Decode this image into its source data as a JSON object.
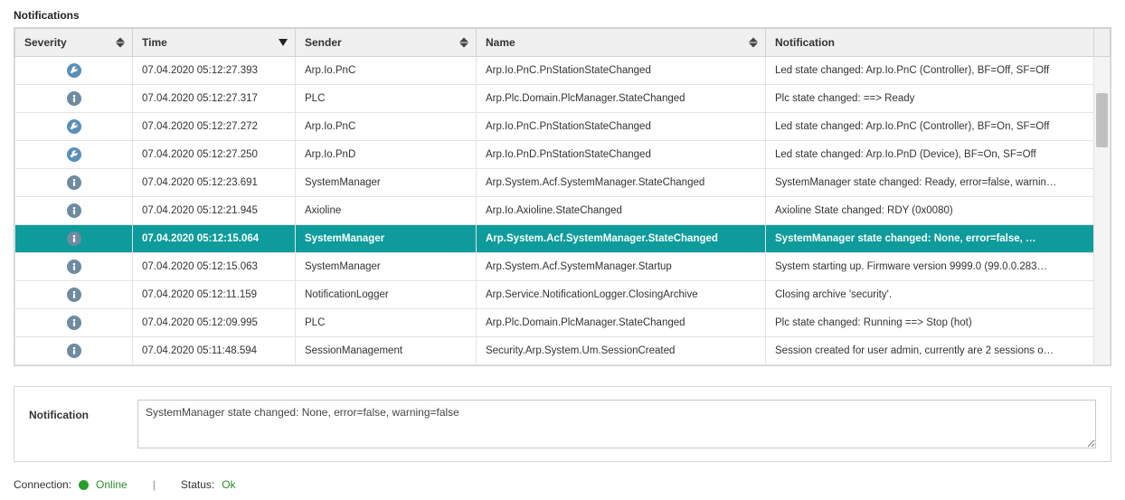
{
  "page_title": "Notifications",
  "columns": {
    "severity": "Severity",
    "time": "Time",
    "sender": "Sender",
    "name": "Name",
    "notification": "Notification"
  },
  "rows": [
    {
      "severity": "wrench",
      "time": "07.04.2020 05:12:27.393",
      "sender": "Arp.Io.PnC",
      "name": "Arp.Io.PnC.PnStationStateChanged",
      "notification": "Led state changed: Arp.Io.PnC (Controller), BF=Off, SF=Off",
      "selected": false
    },
    {
      "severity": "info",
      "time": "07.04.2020 05:12:27.317",
      "sender": "PLC",
      "name": "Arp.Plc.Domain.PlcManager.StateChanged",
      "notification": "Plc state changed: ==> Ready",
      "selected": false
    },
    {
      "severity": "wrench",
      "time": "07.04.2020 05:12:27.272",
      "sender": "Arp.Io.PnC",
      "name": "Arp.Io.PnC.PnStationStateChanged",
      "notification": "Led state changed: Arp.Io.PnC (Controller), BF=On, SF=Off",
      "selected": false
    },
    {
      "severity": "wrench",
      "time": "07.04.2020 05:12:27.250",
      "sender": "Arp.Io.PnD",
      "name": "Arp.Io.PnD.PnStationStateChanged",
      "notification": "Led state changed: Arp.Io.PnD (Device), BF=On, SF=Off",
      "selected": false
    },
    {
      "severity": "info",
      "time": "07.04.2020 05:12:23.691",
      "sender": "SystemManager",
      "name": "Arp.System.Acf.SystemManager.StateChanged",
      "notification": "SystemManager state changed: Ready, error=false, warnin…",
      "selected": false
    },
    {
      "severity": "info",
      "time": "07.04.2020 05:12:21.945",
      "sender": "Axioline",
      "name": "Arp.Io.Axioline.StateChanged",
      "notification": "Axioline State changed: RDY (0x0080)",
      "selected": false
    },
    {
      "severity": "info",
      "time": "07.04.2020 05:12:15.064",
      "sender": "SystemManager",
      "name": "Arp.System.Acf.SystemManager.StateChanged",
      "notification": "SystemManager state changed: None, error=false, …",
      "selected": true
    },
    {
      "severity": "info",
      "time": "07.04.2020 05:12:15.063",
      "sender": "SystemManager",
      "name": "Arp.System.Acf.SystemManager.Startup",
      "notification": "System starting up. Firmware version 9999.0 (99.0.0.283…",
      "selected": false
    },
    {
      "severity": "info",
      "time": "07.04.2020 05:12:11.159",
      "sender": "NotificationLogger",
      "name": "Arp.Service.NotificationLogger.ClosingArchive",
      "notification": "Closing archive 'security'.",
      "selected": false
    },
    {
      "severity": "info",
      "time": "07.04.2020 05:12:09.995",
      "sender": "PLC",
      "name": "Arp.Plc.Domain.PlcManager.StateChanged",
      "notification": "Plc state changed: Running ==> Stop (hot)",
      "selected": false
    },
    {
      "severity": "info",
      "time": "07.04.2020 05:11:48.594",
      "sender": "SessionManagement",
      "name": "Security.Arp.System.Um.SessionCreated",
      "notification": "Session created for user admin, currently are 2 sessions o…",
      "selected": false
    }
  ],
  "detail": {
    "label": "Notification",
    "text": "SystemManager state changed: None, error=false, warning=false"
  },
  "status": {
    "connection_label": "Connection:",
    "connection_value": "Online",
    "status_label": "Status:",
    "status_value": "Ok"
  }
}
